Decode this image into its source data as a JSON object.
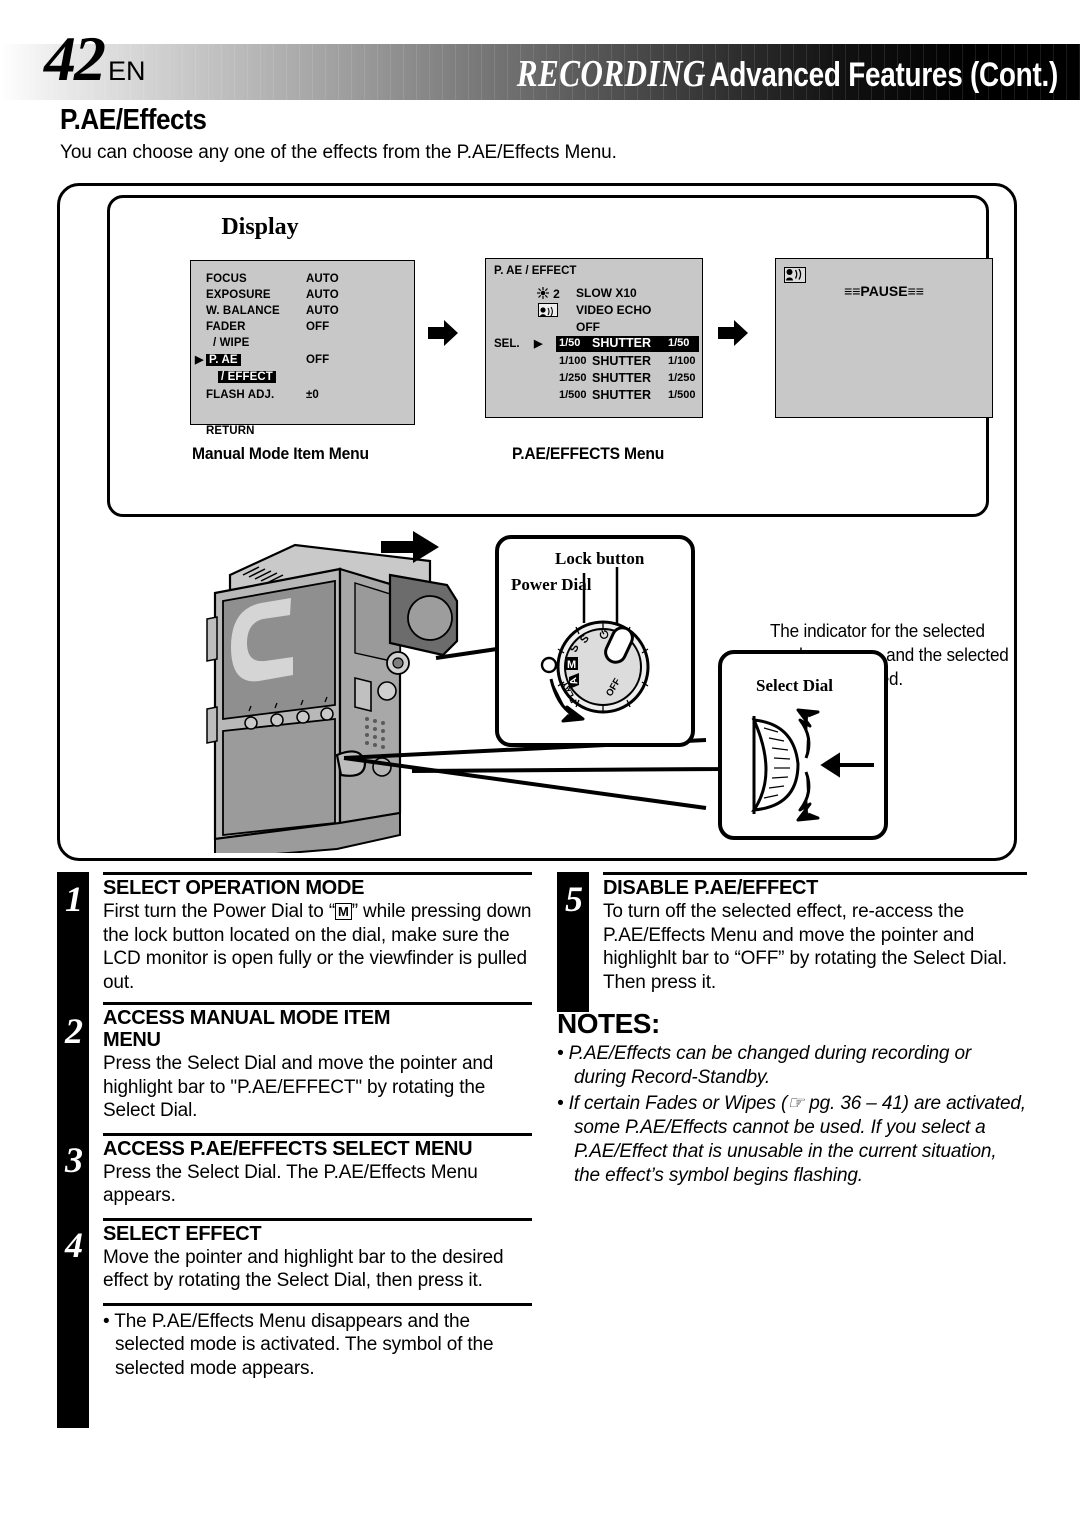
{
  "header": {
    "page_number": "42",
    "language": "EN",
    "title_main": "RECORDING",
    "title_sub": "Advanced Features (Cont.)"
  },
  "section": {
    "title": "P.AE/Effects",
    "intro": "You can choose any one of the effects from the P.AE/Effects Menu."
  },
  "display_panel": {
    "label": "Display",
    "manual_menu": {
      "rows": [
        {
          "label": "FOCUS",
          "value": "AUTO"
        },
        {
          "label": "EXPOSURE",
          "value": "AUTO"
        },
        {
          "label": "W. BALANCE",
          "value": "AUTO"
        },
        {
          "label": "FADER",
          "value": "OFF"
        },
        {
          "label": "/ WIPE",
          "value": ""
        },
        {
          "label": "P. AE",
          "value": "OFF"
        },
        {
          "label": "/ EFFECT",
          "value": ""
        },
        {
          "label": "FLASH ADJ.",
          "value": "±0"
        },
        {
          "label": "RETURN",
          "value": ""
        }
      ],
      "pointer": "▶",
      "highlighted": [
        "P. AE",
        "/ EFFECT"
      ]
    },
    "paeffects_menu": {
      "title": "P. AE / EFFECT",
      "sel_label": "SEL.",
      "pointer": "▶",
      "rows": [
        {
          "icon": "sun-2-icon",
          "icon_text": "2",
          "name": "SLOW X10",
          "value": ""
        },
        {
          "icon": "video-echo-icon",
          "icon_text": "",
          "name": "VIDEO ECHO",
          "value": ""
        },
        {
          "icon": "",
          "icon_text": "",
          "name": "OFF",
          "value": ""
        },
        {
          "icon": "",
          "icon_text": "1/50",
          "name": "SHUTTER",
          "value": "1/50",
          "selected": true
        },
        {
          "icon": "",
          "icon_text": "1/100",
          "name": "SHUTTER",
          "value": "1/100"
        },
        {
          "icon": "",
          "icon_text": "1/250",
          "name": "SHUTTER",
          "value": "1/250"
        },
        {
          "icon": "",
          "icon_text": "1/500",
          "name": "SHUTTER",
          "value": "1/500"
        }
      ]
    },
    "indicator_screen": {
      "mode_icon": "video-echo-icon",
      "pause_text": "≡≡PAUSE≡≡"
    },
    "captions": {
      "left": "Manual Mode Item Menu",
      "middle": "P.AE/EFFECTS Menu",
      "right": "The indicator for the selected mode appears, and the selected mode is engaged."
    }
  },
  "callouts": {
    "lock_button": "Lock button",
    "power_dial": "Power Dial",
    "select_dial": "Select Dial",
    "dial_marks": [
      "S",
      "S",
      "M",
      "A",
      "PLAY",
      "OFF"
    ]
  },
  "steps": [
    {
      "number": "1",
      "title": "SELECT OPERATION MODE",
      "body_before": "First turn the Power Dial to “",
      "body_box": "M",
      "body_after": "” while pressing down the lock button located on the dial, make sure the LCD monitor is open fully or the viewfinder is pulled out."
    },
    {
      "number": "2",
      "title": "ACCESS MANUAL MODE ITEM MENU",
      "body": "Press the Select Dial and move the pointer and highlight bar to \"P.AE/EFFECT\" by rotating the Select Dial."
    },
    {
      "number": "3",
      "title": "ACCESS P.AE/EFFECTS SELECT MENU",
      "body": "Press the Select Dial. The P.AE/Effects Menu appears."
    },
    {
      "number": "4",
      "title": "SELECT EFFECT",
      "body": "Move the pointer and highlight bar to the desired effect by rotating the Select Dial, then press it."
    }
  ],
  "step_four_bullet": "• The P.AE/Effects Menu disappears and the selected mode is activated. The symbol of the selected mode appears.",
  "step_five": {
    "number": "5",
    "title": "DISABLE P.AE/EFFECT",
    "body": "To turn off the selected effect, re-access the P.AE/Effects Menu and move the pointer and highlighlt bar to “OFF” by rotating the Select Dial. Then press it."
  },
  "notes": {
    "title": "NOTES:",
    "items": [
      "• P.AE/Effects can be changed during recording or during Record-Standby.",
      "• If certain Fades or Wipes (☞ pg. 36 – 41) are activated, some P.AE/Effects cannot be used. If you select a P.AE/Effect that is unusable in the current situation, the effect’s symbol begins flashing."
    ]
  },
  "colors": {
    "lcd_background": "#c8c8c8",
    "highlight": "#000000",
    "page_background": "#ffffff"
  }
}
